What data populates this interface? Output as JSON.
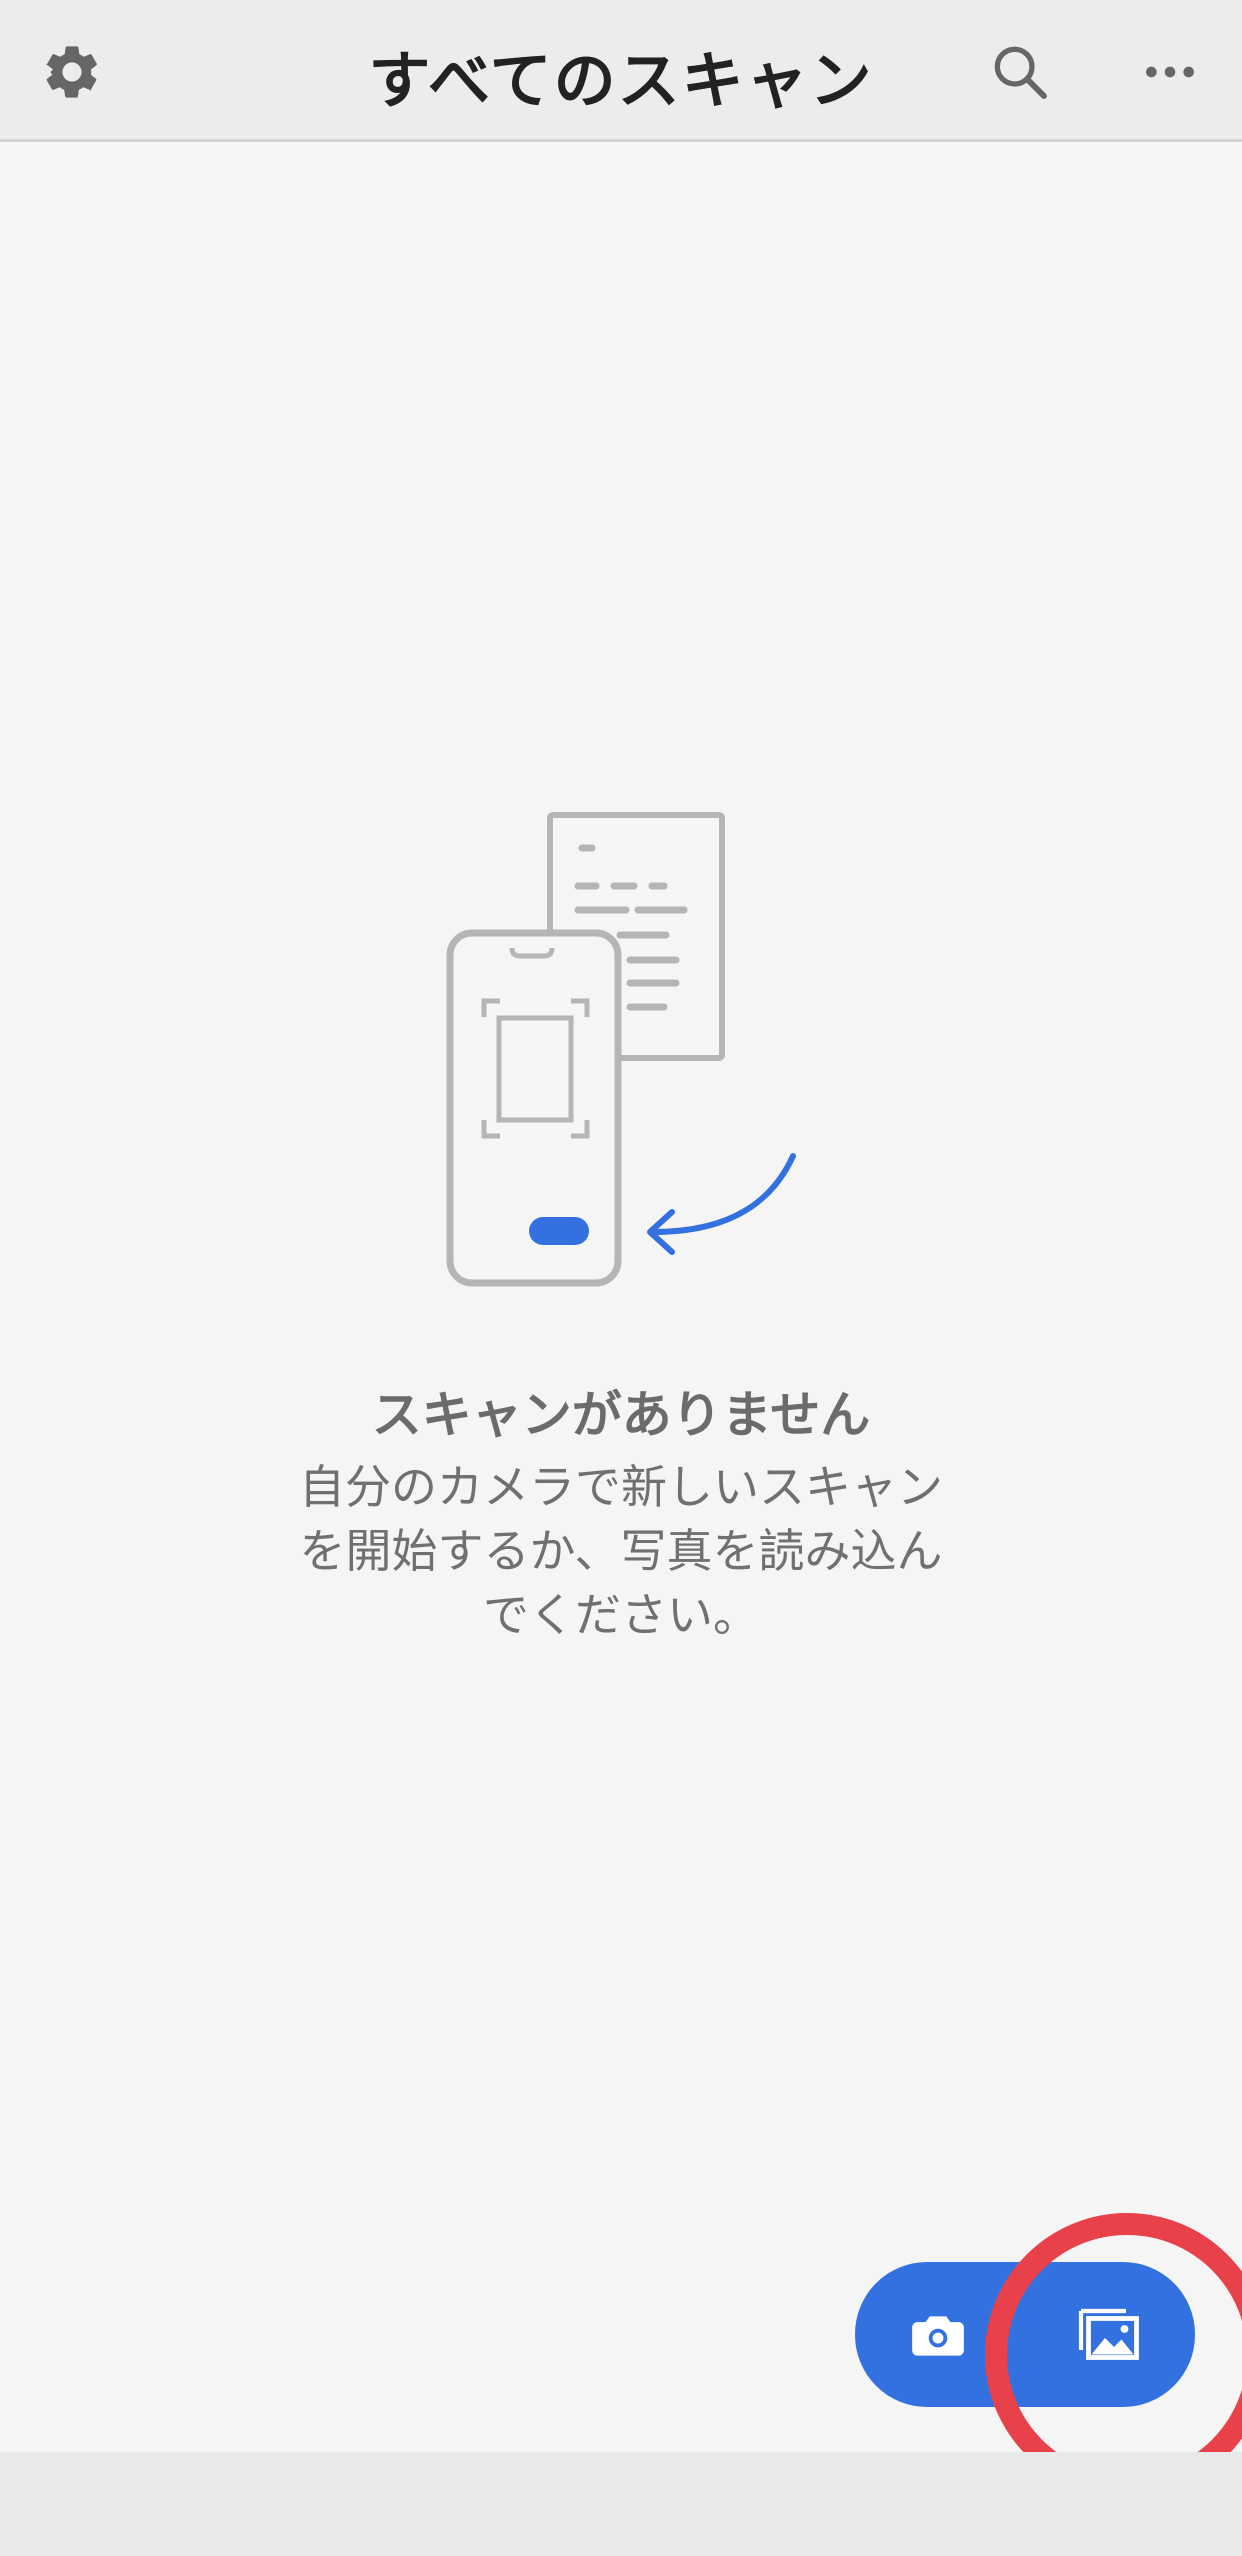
{
  "header": {
    "title": "すべてのスキャン",
    "left_icon": "gear-icon",
    "right_icons": [
      "search-icon",
      "more-horizontal-icon"
    ]
  },
  "empty_state": {
    "illustration": "phone-scan-document-illustration",
    "title": "スキャンがありません",
    "body_lines": [
      "自分のカメラで新しいスキャン",
      "を開始するか、写真を読み込ん",
      "でください。"
    ]
  },
  "fab": {
    "camera_icon": "camera-icon",
    "gallery_icon": "image-gallery-icon"
  },
  "colors": {
    "accent": "#3471e0",
    "highlight": "#e8414a",
    "header_bg": "#ececec",
    "page_bg": "#f5f5f5",
    "illustration_gray": "#b5b5b5"
  }
}
